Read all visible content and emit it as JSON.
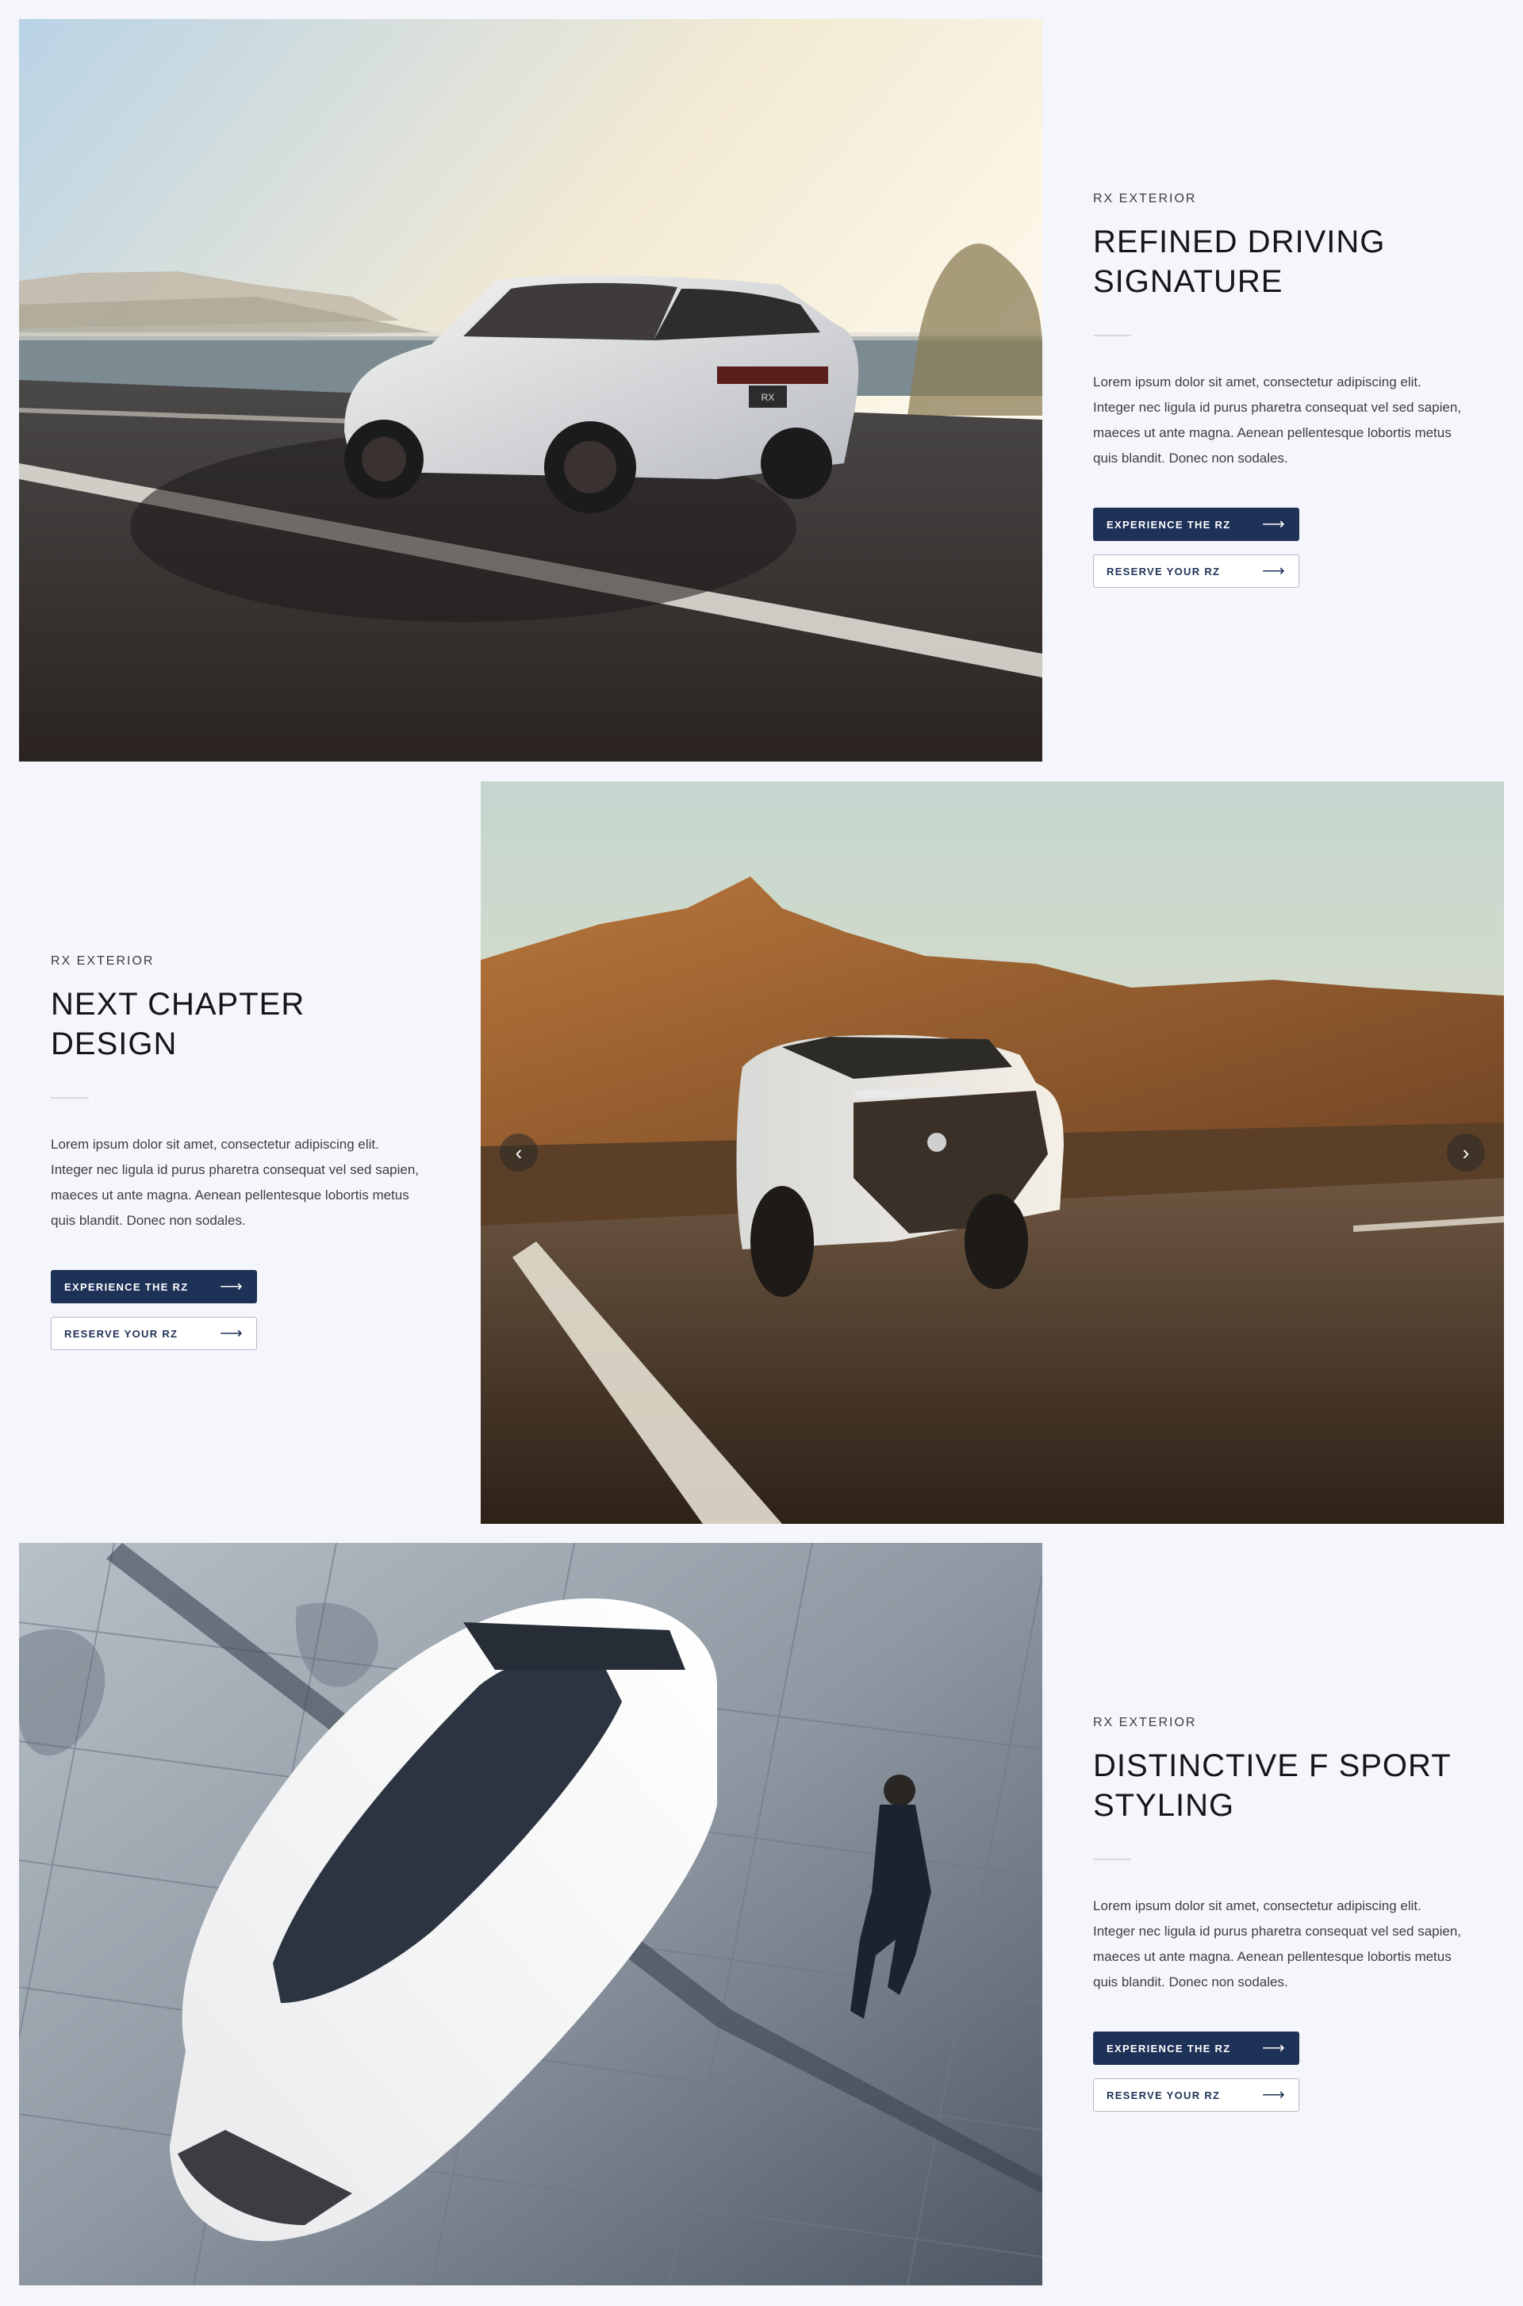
{
  "sections": [
    {
      "eyebrow": "RX EXTERIOR",
      "title_line1": "REFINED DRIVING",
      "title_line2": "SIGNATURE",
      "body": "Lorem ipsum dolor sit amet, consectetur adipiscing elit. Integer nec ligula id purus pharetra consequat vel sed sapien, maeces ut ante magna. Aenean pellentesque lobortis metus quis blandit. Donec non sodales.",
      "primary_label": "EXPERIENCE THE RZ",
      "secondary_label": "RESERVE YOUR RZ",
      "plate_text": "RX"
    },
    {
      "eyebrow": "RX EXTERIOR",
      "title_line1": "NEXT CHAPTER",
      "title_line2": "DESIGN",
      "body": "Lorem ipsum dolor sit amet, consectetur adipiscing elit. Integer nec ligula id purus pharetra consequat vel sed sapien, maeces ut ante magna. Aenean pellentesque lobortis metus quis blandit. Donec non sodales.",
      "primary_label": "EXPERIENCE THE RZ",
      "secondary_label": "RESERVE YOUR RZ"
    },
    {
      "eyebrow": "RX EXTERIOR",
      "title_line1": "DISTINCTIVE F SPORT",
      "title_line2": "STYLING",
      "body": "Lorem ipsum dolor sit amet, consectetur adipiscing elit. Integer nec ligula id purus pharetra consequat vel sed sapien, maeces ut ante magna. Aenean pellentesque lobortis metus quis blandit. Donec non sodales.",
      "primary_label": "EXPERIENCE THE RZ",
      "secondary_label": "RESERVE YOUR RZ"
    }
  ],
  "icons": {
    "button_arrow": "⟶",
    "carousel_prev": "‹",
    "carousel_next": "›"
  },
  "colors": {
    "page_background": "#f5f6fc",
    "primary_button": "#1e3157",
    "heading": "#16161a"
  }
}
